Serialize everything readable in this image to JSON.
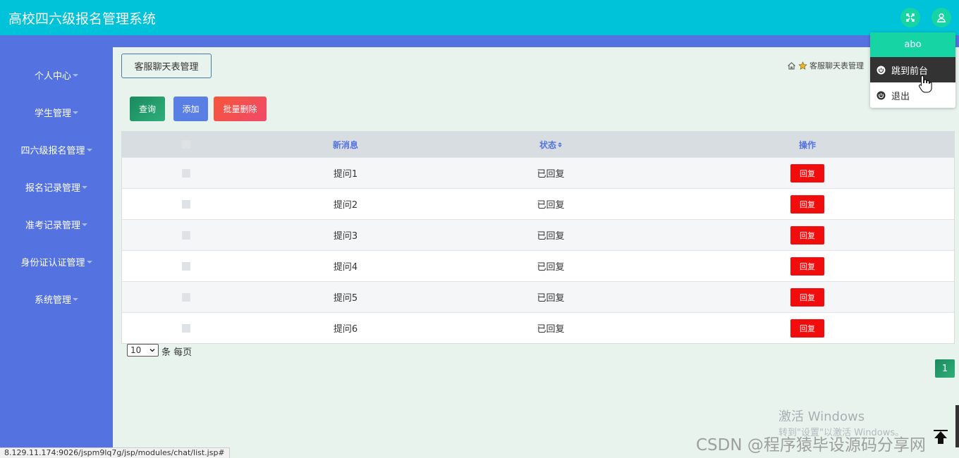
{
  "app": {
    "title": "高校四六级报名管理系统"
  },
  "header": {
    "fullscreen_icon": "expand-icon",
    "user_icon": "user-icon"
  },
  "user_menu": {
    "username": "abo",
    "items": [
      {
        "label": "跳到前台",
        "icon": "power-icon"
      },
      {
        "label": "退出",
        "icon": "power-icon"
      }
    ]
  },
  "sidebar": {
    "items": [
      {
        "label": "个人中心"
      },
      {
        "label": "学生管理"
      },
      {
        "label": "四六级报名管理"
      },
      {
        "label": "报名记录管理"
      },
      {
        "label": "准考记录管理"
      },
      {
        "label": "身份证认证管理"
      },
      {
        "label": "系统管理"
      }
    ]
  },
  "tab": {
    "label": "客服聊天表管理"
  },
  "breadcrumb": {
    "current": "客服聊天表管理"
  },
  "toolbar": {
    "query_label": "查询",
    "add_label": "添加",
    "batch_delete_label": "批量删除"
  },
  "table": {
    "columns": {
      "message": "新消息",
      "status": "状态",
      "action": "操作"
    },
    "rows": [
      {
        "message": "提问1",
        "status": "已回复",
        "action": "回复"
      },
      {
        "message": "提问2",
        "status": "已回复",
        "action": "回复"
      },
      {
        "message": "提问3",
        "status": "已回复",
        "action": "回复"
      },
      {
        "message": "提问4",
        "status": "已回复",
        "action": "回复"
      },
      {
        "message": "提问5",
        "status": "已回复",
        "action": "回复"
      },
      {
        "message": "提问6",
        "status": "已回复",
        "action": "回复"
      }
    ]
  },
  "pagination": {
    "page_size": "10",
    "page_size_label": "条 每页",
    "current_page": "1"
  },
  "watermark": {
    "windows_line1": "激活 Windows",
    "windows_line2": "转到\"设置\"以激活 Windows。",
    "csdn": "CSDN @程序猿毕设源码分享网"
  },
  "statusbar": {
    "url": "8.129.11.174:9026/jspm9lq7g/jsp/modules/chat/list.jsp#"
  },
  "colors": {
    "topbar": "#00c2d8",
    "sidebar": "#5473e0",
    "accent_green": "#17d4a5",
    "danger": "#f20d0d"
  }
}
